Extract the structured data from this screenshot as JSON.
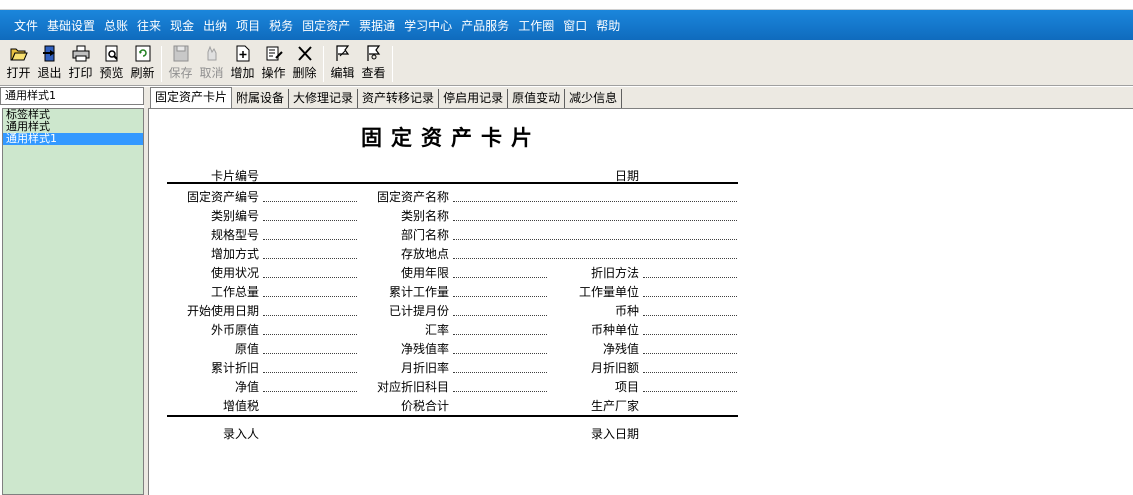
{
  "app": {
    "logo": ""
  },
  "menu": [
    "文件",
    "基础设置",
    "总账",
    "往来",
    "现金",
    "出纳",
    "项目",
    "税务",
    "固定资产",
    "票据通",
    "学习中心",
    "产品服务",
    "工作圈",
    "窗口",
    "帮助"
  ],
  "toolbar": {
    "open": "打开",
    "exit": "退出",
    "print": "打印",
    "preview": "预览",
    "refresh": "刷新",
    "save": "保存",
    "cancel": "取消",
    "add": "增加",
    "operate": "操作",
    "delete": "删除",
    "edit": "编辑",
    "view": "查看"
  },
  "left": {
    "header": "通用样式1",
    "items": [
      "标签样式",
      "通用样式",
      "通用样式1"
    ]
  },
  "tabs": [
    "固定资产卡片",
    "附属设备",
    "大修理记录",
    "资产转移记录",
    "停启用记录",
    "原值变动",
    "减少信息"
  ],
  "card": {
    "title": "固定资产卡片",
    "card_no": "卡片编号",
    "date": "日期",
    "asset_code": "固定资产编号",
    "asset_name": "固定资产名称",
    "category_code": "类别编号",
    "category_name": "类别名称",
    "spec": "规格型号",
    "dept": "部门名称",
    "add_method": "增加方式",
    "location": "存放地点",
    "use_status": "使用状况",
    "use_years": "使用年限",
    "dep_method": "折旧方法",
    "total_work": "工作总量",
    "acc_work": "累计工作量",
    "work_unit": "工作量单位",
    "start_date": "开始使用日期",
    "dep_months": "已计提月份",
    "currency": "币种",
    "fc_value": "外币原值",
    "rate": "汇率",
    "currency_unit": "币种单位",
    "orig_value": "原值",
    "salvage_rate": "净残值率",
    "salvage": "净残值",
    "acc_dep": "累计折旧",
    "month_rate": "月折旧率",
    "month_dep": "月折旧额",
    "net_value": "净值",
    "dep_account": "对应折旧科目",
    "project": "项目",
    "vat": "增值税",
    "total_tax": "价税合计",
    "manufacturer": "生产厂家",
    "entered_by": "录入人",
    "entry_date": "录入日期"
  }
}
